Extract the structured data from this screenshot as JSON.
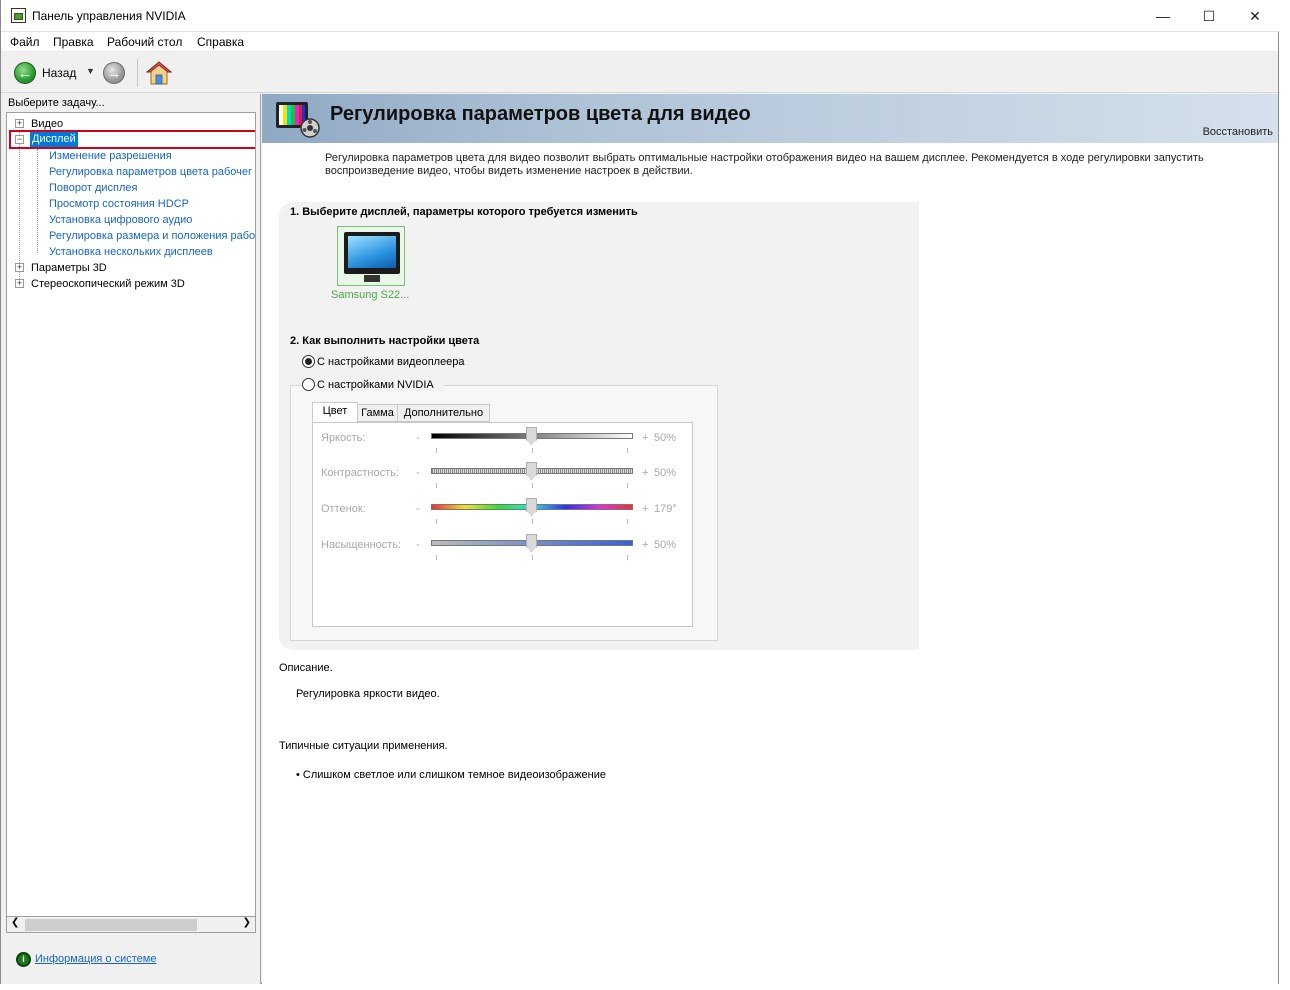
{
  "window": {
    "title": "Панель управления NVIDIA",
    "controls": {
      "minimize": "—",
      "maximize": "☐",
      "close": "✕"
    }
  },
  "menu": [
    "Файл",
    "Правка",
    "Рабочий стол",
    "Справка"
  ],
  "toolbar": {
    "back_label": "Назад"
  },
  "sidebar": {
    "task_label": "Выберите задачу...",
    "tree": {
      "video": "Видео",
      "display": "Дисплей",
      "display_children": [
        "Изменение разрешения",
        "Регулировка параметров цвета рабочег",
        "Поворот дисплея",
        "Просмотр состояния HDCP",
        "Установка цифрового аудио",
        "Регулировка размера и положения рабо",
        "Установка нескольких дисплеев"
      ],
      "params3d": "Параметры 3D",
      "stereo3d": "Стереоскопический режим 3D"
    },
    "sysinfo_link": "Информация о системе"
  },
  "main": {
    "page_title": "Регулировка параметров цвета для видео",
    "restore": "Восстановить",
    "intro": "Регулировка параметров цвета для видео позволит выбрать оптимальные настройки отображения видео на вашем дисплее. Рекомендуется в ходе регулировки запустить воспроизведение видео, чтобы видеть изменение настроек в действии.",
    "section1_title": "1. Выберите дисплей, параметры которого требуется изменить",
    "display_name": "Samsung S22...",
    "section2_title": "2. Как выполнить настройки цвета",
    "radio_player": "С настройками видеоплеера",
    "radio_nvidia": "С настройками NVIDIA",
    "selected_option": "player",
    "tabs": [
      "Цвет",
      "Гамма",
      "Дополнительно"
    ],
    "active_tab": "Цвет",
    "sliders": [
      {
        "label": "Яркость:",
        "minus": "-",
        "plus": "+",
        "value": "50%",
        "fraction": 0.5
      },
      {
        "label": "Контрастность:",
        "minus": "-",
        "plus": "+",
        "value": "50%",
        "fraction": 0.5
      },
      {
        "label": "Оттенок:",
        "minus": "-",
        "plus": "+",
        "value": "179°",
        "fraction": 0.5
      },
      {
        "label": "Насыщенность:",
        "minus": "-",
        "plus": "+",
        "value": "50%",
        "fraction": 0.5
      }
    ],
    "description_title": "Описание.",
    "description_text": "Регулировка яркости видео.",
    "usage_title": "Типичные ситуации применения.",
    "usage_item": "• Слишком светлое или слишком темное видеоизображение"
  },
  "colors": {
    "link": "#1565c0",
    "selection": "#0078d7",
    "highlight_box": "#d0021b",
    "display_label": "#4aa94a"
  }
}
